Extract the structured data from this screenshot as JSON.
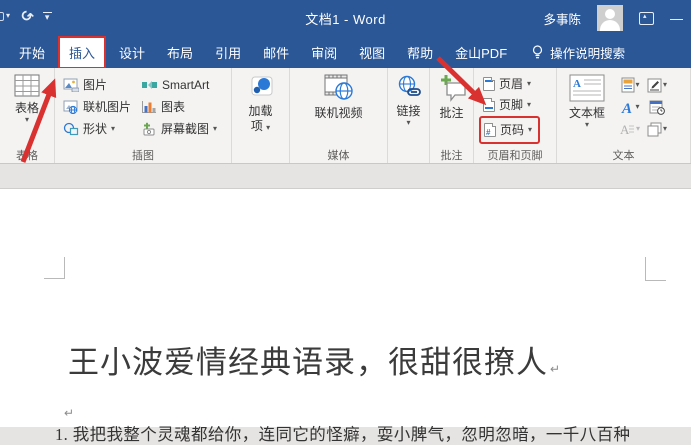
{
  "colors": {
    "titlebar_blue": "#2b5797",
    "annotation_red": "#d93030",
    "accent_blue": "#2b79d7",
    "ribbon_bg": "#f4f3f2",
    "page_bg": "#ffffff"
  },
  "icons": {
    "dropdown": "▾",
    "redo": "↻",
    "minimize": "—",
    "paragraph_mark": "↵"
  },
  "titlebar": {
    "title": "文档1 - Word",
    "user_name": "多事陈"
  },
  "tabs": {
    "items": [
      {
        "label": "开始"
      },
      {
        "label": "插入",
        "selected": true
      },
      {
        "label": "设计"
      },
      {
        "label": "布局"
      },
      {
        "label": "引用"
      },
      {
        "label": "邮件"
      },
      {
        "label": "审阅"
      },
      {
        "label": "视图"
      },
      {
        "label": "帮助"
      },
      {
        "label": "金山PDF"
      }
    ],
    "search_label": "操作说明搜索"
  },
  "ribbon": {
    "table_group": {
      "label": "表格",
      "button": "表格"
    },
    "illustrations_group": {
      "label": "插图",
      "picture": "图片",
      "online_picture": "联机图片",
      "shapes": "形状",
      "smartart": "SmartArt",
      "chart": "图表",
      "screenshot": "屏幕截图"
    },
    "addins_group": {
      "label": "",
      "line1": "加载",
      "line2": "项"
    },
    "media_group": {
      "label": "媒体",
      "online_video": "联机视频"
    },
    "links_group": {
      "label": "",
      "links": "链接"
    },
    "comments_group": {
      "label": "批注",
      "comment": "批注"
    },
    "header_footer_group": {
      "label": "页眉和页脚",
      "header": "页眉",
      "footer": "页脚",
      "page_number": "页码"
    },
    "text_group": {
      "label": "文本",
      "textbox": "文本框"
    }
  },
  "document": {
    "title": "王小波爱情经典语录，很甜很撩人",
    "body": "1. 我把我整个灵魂都给你，连同它的怪癖，耍小脾气，忽明忽暗，一千八百种"
  }
}
